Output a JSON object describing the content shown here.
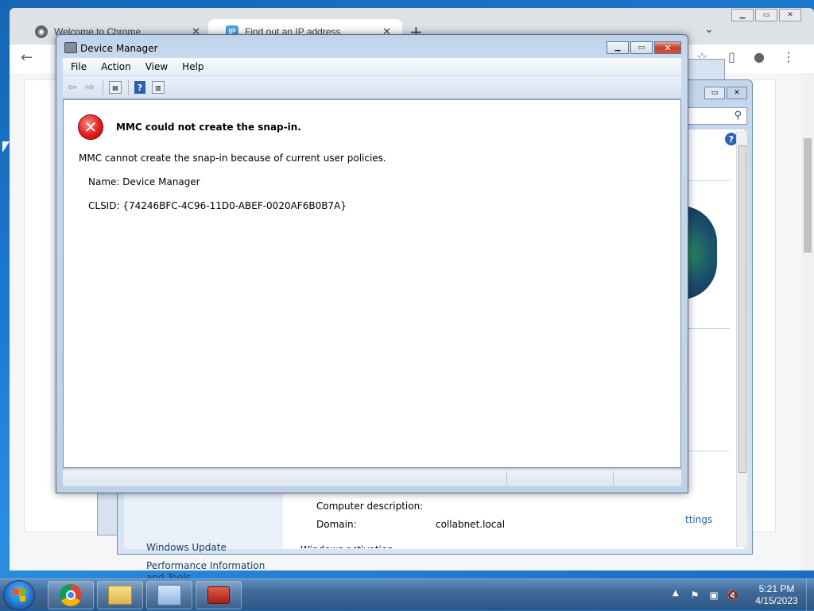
{
  "chrome": {
    "tabs": [
      {
        "title": "Welcome to Chrome",
        "active": false
      },
      {
        "title": "Find out an IP address",
        "active": true
      }
    ],
    "favicon_ip": "IP"
  },
  "system_panel": {
    "left_links": [
      "Windows Update",
      "Performance Information and Tools"
    ],
    "settings_link": "ttings",
    "fields": [
      {
        "label": "Computer description:",
        "value": ""
      },
      {
        "label": "Domain:",
        "value": "collabnet.local"
      }
    ],
    "cut_heading": "Windows activation"
  },
  "mmc": {
    "title": "Device Manager",
    "menu": [
      "File",
      "Action",
      "View",
      "Help"
    ],
    "error": {
      "heading": "MMC could not create the snap-in.",
      "text": "MMC cannot create the snap-in because of current user policies.",
      "name_line": "Name: Device Manager",
      "clsid_line": "CLSID: {74246BFC-4C96-11D0-ABEF-0020AF6B0B7A}"
    }
  },
  "taskbar": {
    "time": "5:21 PM",
    "date": "4/15/2023",
    "apps": [
      "chrome-icon",
      "folder-icon",
      "control-panel-icon",
      "toolbox-icon"
    ]
  }
}
